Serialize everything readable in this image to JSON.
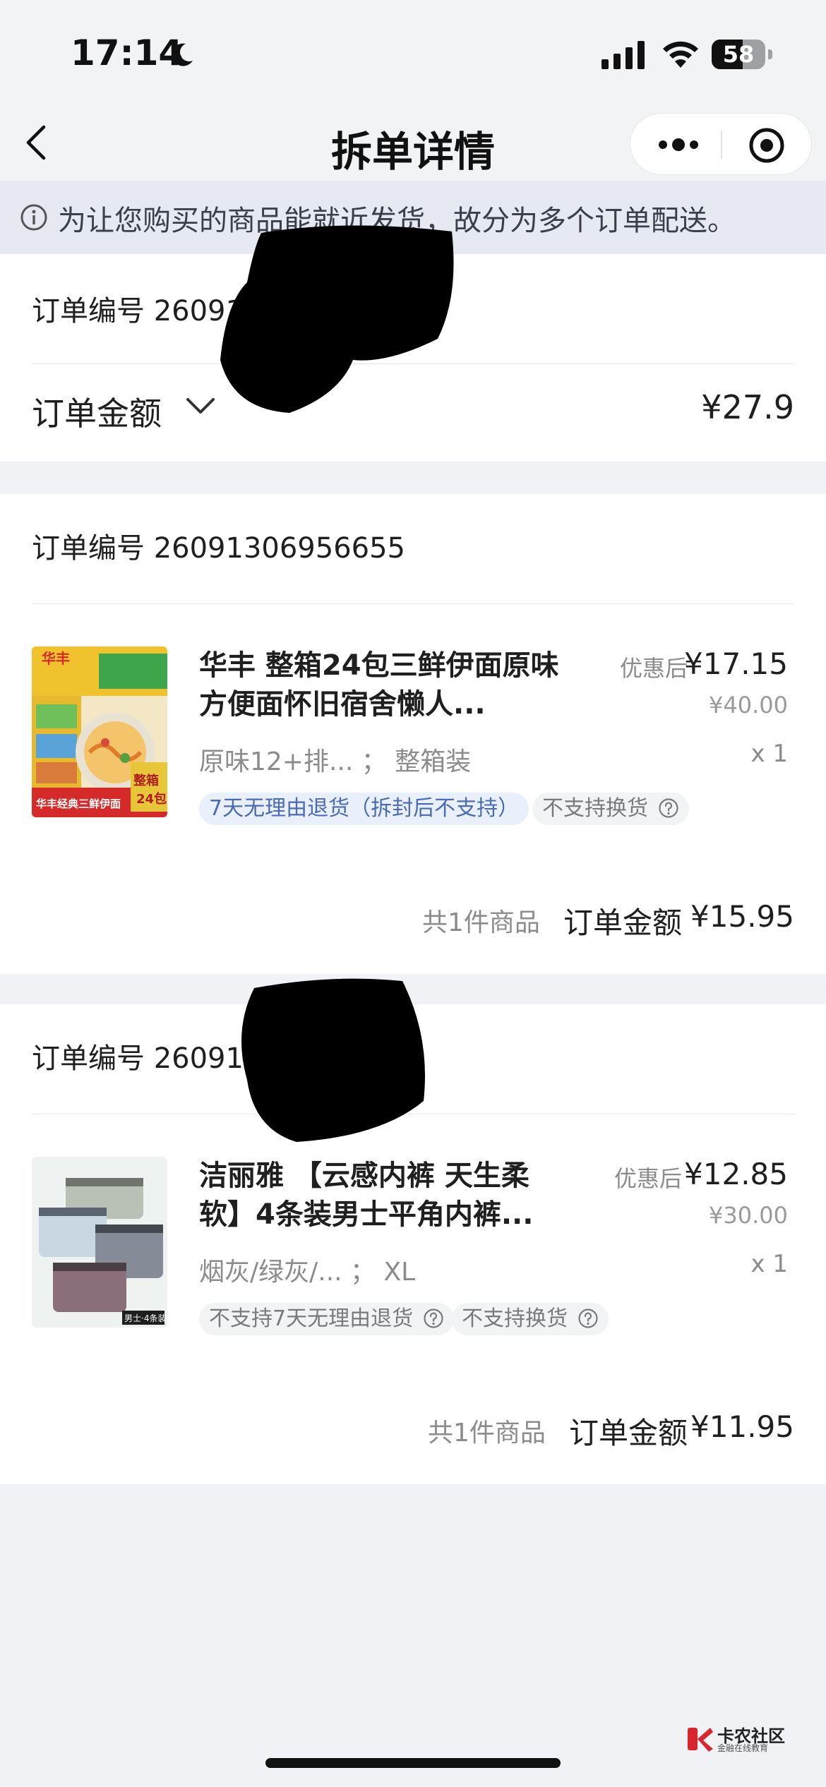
{
  "status_bar": {
    "time": "17:14",
    "battery_level": "58"
  },
  "nav": {
    "title": "拆单详情"
  },
  "notice": {
    "text": "为让您购买的商品能就近发货，故分为多个订单配送。"
  },
  "summary_order": {
    "order_no_label": "订单编号 26091",
    "amount_label": "订单金额",
    "amount_value": "¥27.9"
  },
  "orders": [
    {
      "order_no_label": "订单编号 26091306956655",
      "product": {
        "title": "华丰 整箱24包三鲜伊面原味方便面怀旧宿舍懒人...",
        "sku": "原味12+排... ； 整箱装",
        "price_label": "优惠后",
        "price_now": "¥17.15",
        "price_orig": "¥40.00",
        "qty": "x 1",
        "tags": [
          "7天无理由退货（拆封后不支持）",
          "不支持换货"
        ],
        "image_texts": [
          "华丰",
          "整箱",
          "24包",
          "华丰经典三鲜伊面"
        ]
      },
      "count_text": "共1件商品",
      "sum_label": "订单金额",
      "sum_value": "¥15.95"
    },
    {
      "order_no_label": "订单编号 26091",
      "product": {
        "title": "洁丽雅 【云感内裤 天生柔软】4条装男士平角内裤...",
        "sku": "烟灰/绿灰/... ； XL",
        "price_label": "优惠后",
        "price_now": "¥12.85",
        "price_orig": "¥30.00",
        "qty": "x 1",
        "tags": [
          "不支持7天无理由退货",
          "不支持换货"
        ],
        "image_texts": [
          "男士·4条装"
        ]
      },
      "count_text": "共1件商品",
      "sum_label": "订单金额",
      "sum_value": "¥11.95"
    }
  ],
  "watermark": {
    "title": "卡农社区",
    "subtitle": "金融在线教育"
  },
  "colors": {
    "background": "#f0f2f5",
    "notice_bg": "#e6e8f2",
    "tag_blue_bg": "#e9effb",
    "tag_blue_text": "#4a6cb3",
    "text_primary": "#1f1f1f",
    "text_secondary": "#8c8c8c"
  }
}
